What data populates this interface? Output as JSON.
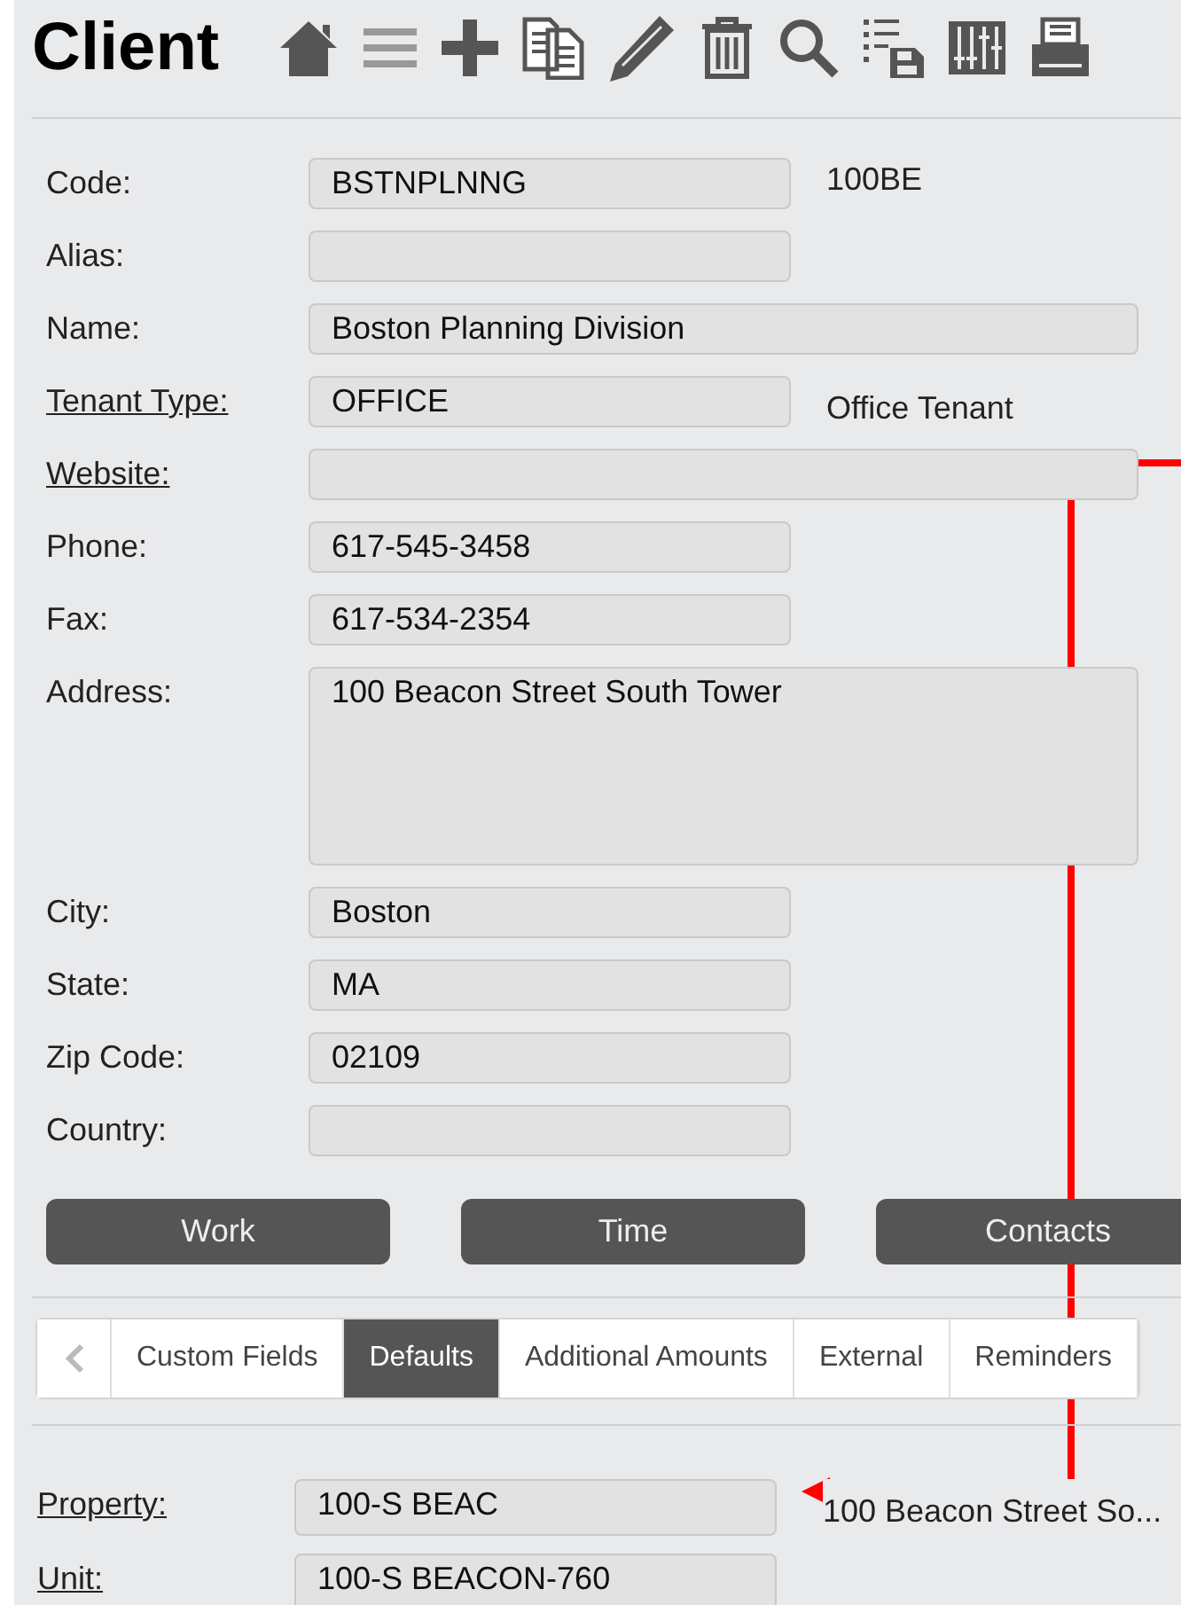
{
  "header": {
    "title": "Client",
    "toolbar": [
      {
        "kind": "home"
      },
      {
        "kind": "list"
      },
      {
        "kind": "add"
      },
      {
        "kind": "copy"
      },
      {
        "kind": "edit"
      },
      {
        "kind": "delete"
      },
      {
        "kind": "search"
      },
      {
        "kind": "save-list"
      },
      {
        "kind": "sliders"
      },
      {
        "kind": "print"
      }
    ]
  },
  "fields": [
    {
      "label": "Code:",
      "link": false,
      "value": "BSTNPLNNG",
      "wide": false,
      "note": "100BE"
    },
    {
      "label": "Alias:",
      "link": false,
      "wide": false
    },
    {
      "label": "Name:",
      "link": false,
      "value": "Boston Planning Division",
      "wide": true
    },
    {
      "label": "Tenant Type:",
      "link": true,
      "value": "OFFICE",
      "wide": false,
      "note": "Office Tenant"
    },
    {
      "label": "Website:",
      "link": true,
      "wide": true
    },
    {
      "label": "Phone:",
      "link": false,
      "value": "617-545-3458",
      "wide": false
    },
    {
      "label": "Fax:",
      "link": false,
      "value": "617-534-2354",
      "wide": false
    },
    {
      "label": "Address:",
      "link": false,
      "value": "100 Beacon Street South Tower",
      "wide": true,
      "multiline": true
    },
    {
      "label": "City:",
      "link": false,
      "value": "Boston",
      "wide": false
    },
    {
      "label": "State:",
      "link": false,
      "value": "MA",
      "wide": false
    },
    {
      "label": "Zip Code:",
      "link": false,
      "value": "02109",
      "wide": false
    },
    {
      "label": "Country:",
      "link": false,
      "wide": false
    }
  ],
  "buttons": [
    "Work",
    "Time",
    "Contacts"
  ],
  "tabs": [
    {
      "label": "Custom Fields",
      "selected": false
    },
    {
      "label": "Defaults",
      "selected": true
    },
    {
      "label": "Additional Amounts",
      "selected": false
    },
    {
      "label": "External",
      "selected": false
    },
    {
      "label": "Reminders",
      "selected": false
    }
  ],
  "defaults": [
    {
      "label": "Property:",
      "link": true,
      "value": "100-S BEAC",
      "note": "100 Beacon Street So..."
    },
    {
      "label": "Unit:",
      "link": true,
      "value": "100-S BEACON-760"
    }
  ]
}
